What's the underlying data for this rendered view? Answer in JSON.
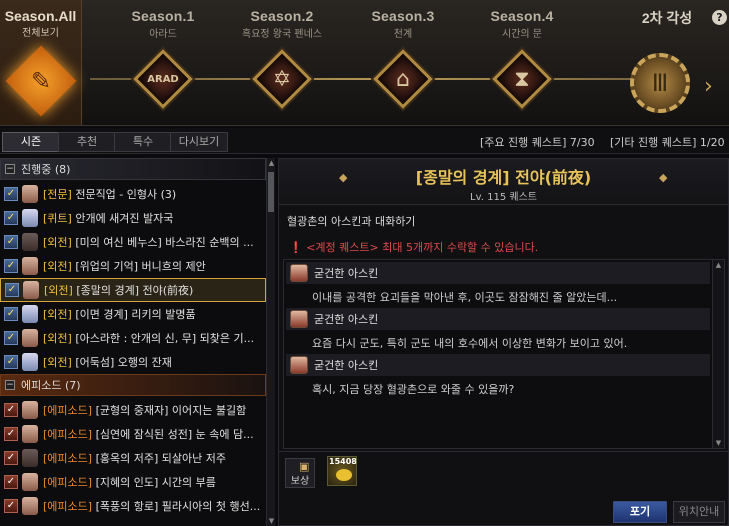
{
  "seasons": {
    "all": {
      "title": "Season.All",
      "subtitle": "전체보기"
    },
    "items": [
      {
        "title": "Season.1",
        "subtitle": "아라드",
        "emblem": "ARAD"
      },
      {
        "title": "Season.2",
        "subtitle": "흑요정 왕국 펜네스",
        "emblem": "✡"
      },
      {
        "title": "Season.3",
        "subtitle": "천계",
        "emblem": "⌂"
      },
      {
        "title": "Season.4",
        "subtitle": "시간의 문",
        "emblem": "⧗"
      }
    ],
    "awaken": {
      "title": "2차 각성",
      "emblem": "Ⅲ"
    },
    "help": "?"
  },
  "tabs": [
    {
      "label": "시즌",
      "active": true
    },
    {
      "label": "추천",
      "active": false
    },
    {
      "label": "특수",
      "active": false
    },
    {
      "label": "다시보기",
      "active": false
    }
  ],
  "counts": {
    "main": "[주요 진행 퀘스트]  7/30",
    "other": "[기타 진행 퀘스트]  1/20"
  },
  "groups": {
    "in_progress": {
      "label": "진행중 (8)",
      "quests": [
        {
          "tag": "[전문]",
          "text": " 전문직업 - 인형사 (3)"
        },
        {
          "tag": "[퀴트]",
          "text": " 안개에 새겨진 발자국"
        },
        {
          "tag": "[외전]",
          "text": " [미의 여신 베누스] 바스라진 순백의 ..."
        },
        {
          "tag": "[외전]",
          "text": " [위업의 기억] 버니흐의 제안"
        },
        {
          "tag": "[외전]",
          "text": " [종말의 경계] 전야(前夜)"
        },
        {
          "tag": "[외전]",
          "text": " [이면 경계] 리키의 발명품"
        },
        {
          "tag": "[외전]",
          "text": " [아스라한 : 안개의 신, 무] 되찾은 기..."
        },
        {
          "tag": "[외전]",
          "text": " [어둑섬] 오행의 잔재"
        }
      ]
    },
    "episodes": {
      "label": "에피소드 (7)",
      "quests": [
        {
          "tag": "[에피소드]",
          "text": " [균형의 중재자] 이어지는 불길함"
        },
        {
          "tag": "[에피소드]",
          "text": " [심연에 잠식된 성전] 눈 속에 담..."
        },
        {
          "tag": "[에피소드]",
          "text": " [홍옥의 저주] 되살아난 저주"
        },
        {
          "tag": "[에피소드]",
          "text": " [지혜의 인도] 시간의 부름"
        },
        {
          "tag": "[에피소드]",
          "text": " [폭풍의 항로] 필라시아의 첫 행선..."
        }
      ]
    }
  },
  "detail": {
    "title": "[종말의 경계] 전야(前夜)",
    "level": "Lv. 115 퀘스트",
    "description": "혈광촌의 아스킨과 대화하기",
    "warning": "<계정 퀘스트> 최대 5개까지 수락할 수 있습니다.",
    "dialog": [
      {
        "speaker": "굳건한 아스킨",
        "text": "이내를 공격한 요괴들을 막아낸 후, 이곳도 잠잠해진 줄 알았는데..."
      },
      {
        "speaker": "굳건한 아스킨",
        "text": "요즘 다시 군도, 특히 군도 내의 호수에서 이상한 변화가 보이고 있어."
      },
      {
        "speaker": "굳건한 아스킨",
        "text": "혹시, 지금 당장 혈광촌으로 와줄 수 있을까?"
      }
    ],
    "reward_label": "보상",
    "reward_item_count": "15408",
    "buttons": {
      "give_up": "포기",
      "location": "위치안내"
    }
  }
}
